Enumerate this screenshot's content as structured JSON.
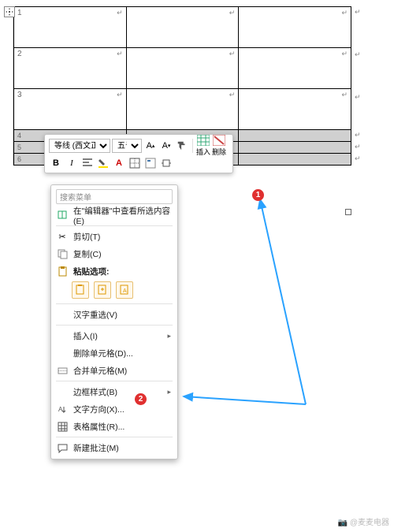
{
  "table": {
    "rows": [
      {
        "label": "1",
        "thin": false
      },
      {
        "label": "2",
        "thin": false
      },
      {
        "label": "3",
        "thin": false
      },
      {
        "label": "4",
        "thin": true
      },
      {
        "label": "5",
        "thin": true
      },
      {
        "label": "6",
        "thin": true
      }
    ],
    "para_mark": "↵"
  },
  "mini_toolbar": {
    "font_family": "等线 (西文正文)",
    "font_size": "五号",
    "insert_label": "插入",
    "delete_label": "删除"
  },
  "context_menu": {
    "search_placeholder": "搜索菜单",
    "items": {
      "lookup": "在\"编辑器\"中查看所选内容(E)",
      "cut": "剪切(T)",
      "copy": "复制(C)",
      "paste_options": "粘贴选项:",
      "ime": "汉字重选(V)",
      "insert": "插入(I)",
      "delete_cells": "删除单元格(D)...",
      "merge_cells": "合并单元格(M)",
      "border_styles": "边框样式(B)",
      "text_direction": "文字方向(X)...",
      "table_properties": "表格属性(R)...",
      "new_comment": "新建批注(M)"
    }
  },
  "annotations": {
    "badge1": "1",
    "badge2": "2"
  },
  "watermark": "@麦麦电器"
}
